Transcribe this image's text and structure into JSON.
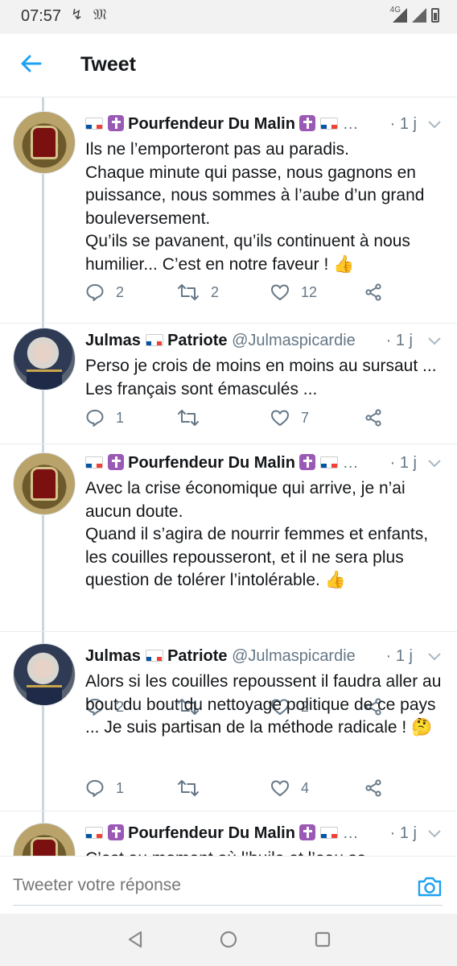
{
  "status_bar": {
    "time": "07:57",
    "notif_icons": [
      "↯",
      "𝔐"
    ],
    "network": "4G"
  },
  "header": {
    "title": "Tweet"
  },
  "colors": {
    "accent": "#1da1f2",
    "muted": "#657786",
    "line": "#ccd6dd"
  },
  "tweets": [
    {
      "name": "Pourfendeur Du Malin",
      "handle": "…",
      "time": "· 1 j",
      "text": "Ils ne l’emporteront pas au paradis.\nChaque minute qui passe, nous gagnons en puissance, nous sommes à l’aube d’un grand bouleversement.\nQu’ils se pavanent, qu’ils continuent à nous humilier... C’est en notre faveur ! 👍",
      "replies": "2",
      "retweets": "2",
      "likes": "12"
    },
    {
      "name": "Julmas",
      "name_suffix": "Patriote",
      "handle": "@Julmaspicardie",
      "time": "· 1 j",
      "text": "Perso je crois de moins en moins au sursaut ... Les français sont émasculés ...",
      "replies": "1",
      "retweets": "",
      "likes": "7"
    },
    {
      "name": "Pourfendeur Du Malin",
      "handle": "…",
      "time": "· 1 j",
      "text": "Avec la crise économique qui arrive, je n’ai aucun doute.\nQuand il s’agira de nourrir femmes et enfants, les couilles repousseront, et il ne sera plus question de tolérer l’intolérable. 👍",
      "replies": "2",
      "retweets": "",
      "likes": "2"
    },
    {
      "name": "Julmas",
      "name_suffix": "Patriote",
      "handle": "@Julmaspicardie",
      "time": "· 1 j",
      "text": "Alors si les couilles repoussent il faudra aller au bout du bout du nettoyage politique de ce pays ... Je suis partisan de la méthode radicale ! 🤔",
      "replies": "1",
      "retweets": "",
      "likes": "4"
    },
    {
      "name": "Pourfendeur Du Malin",
      "handle": "…",
      "time": "· 1 j",
      "text": "C’est au moment où l’huile et l’eau se"
    }
  ],
  "reply": {
    "placeholder": "Tweeter votre réponse"
  }
}
